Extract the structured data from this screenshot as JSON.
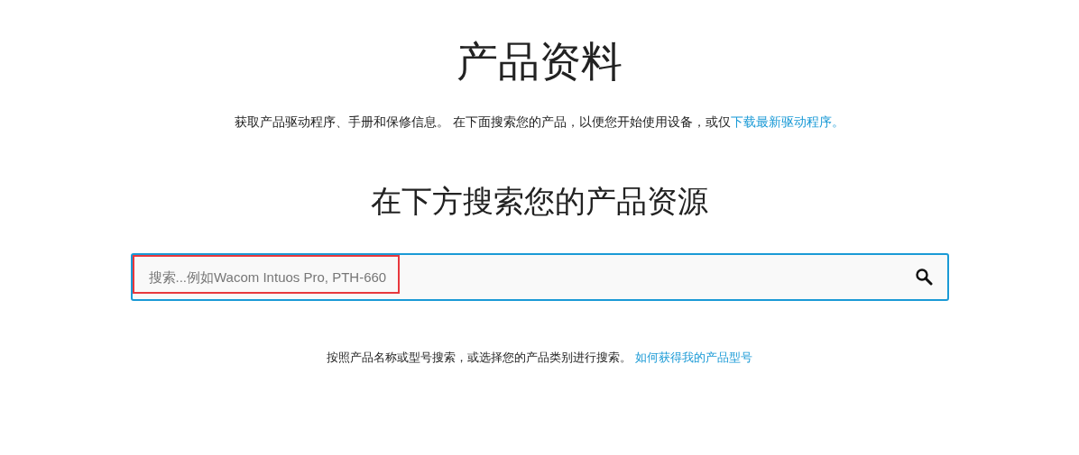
{
  "page_title": "产品资料",
  "intro": {
    "text": "获取产品驱动程序、手册和保修信息。 在下面搜索您的产品，以便您开始使用设备，或仅",
    "link": "下载最新驱动程序。"
  },
  "search_heading": "在下方搜索您的产品资源",
  "search": {
    "placeholder": "搜索...例如Wacom Intuos Pro, PTH-660",
    "highlighted": true
  },
  "hint": {
    "text": "按照产品名称或型号搜索，或选择您的产品类别进行搜索。 ",
    "link": "如何获得我的产品型号"
  }
}
